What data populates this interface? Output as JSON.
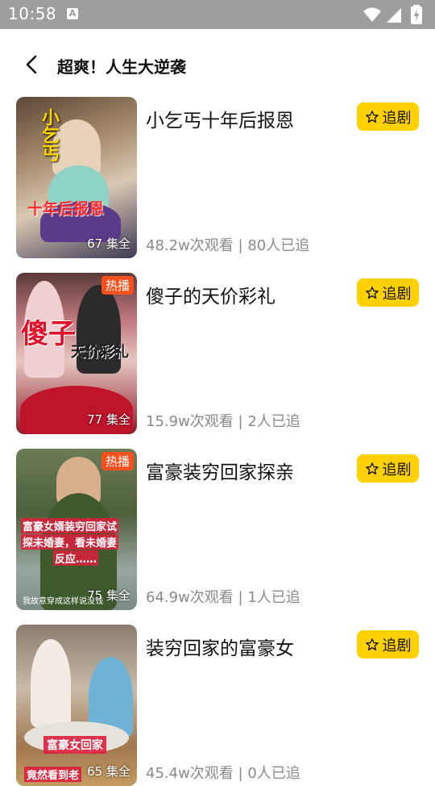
{
  "status_bar": {
    "time": "10:58",
    "a_icon": "A"
  },
  "header": {
    "title": "超爽！人生大逆袭"
  },
  "items": [
    {
      "title": "小乞丐十年后报恩",
      "follow_label": "追剧",
      "views": "48.2w次观看",
      "followers": "80人已追",
      "episodes": "67 集全",
      "hot": false,
      "overlay_lines": [
        "小乞丐",
        "十年后报恩"
      ]
    },
    {
      "title": "傻子的天价彩礼",
      "follow_label": "追剧",
      "views": "15.9w次观看",
      "followers": "2人已追",
      "episodes": "77 集全",
      "hot": true,
      "hot_label": "热播",
      "overlay_lines": [
        "傻子",
        "天价彩礼"
      ]
    },
    {
      "title": "富豪装穷回家探亲",
      "follow_label": "追剧",
      "views": "64.9w次观看",
      "followers": "1人已追",
      "episodes": "75 集全",
      "hot": true,
      "hot_label": "热播",
      "overlay_lines": [
        "富豪女婿装穷回家试",
        "探未婚妻，看未婚妻",
        "反应……",
        "我故意穿成这样说没钱"
      ]
    },
    {
      "title": "装穷回家的富豪女",
      "follow_label": "追剧",
      "views": "45.4w次观看",
      "followers": "0人已追",
      "episodes": "65 集全",
      "hot": false,
      "overlay_lines": [
        "富豪女回家",
        "竟然看到老"
      ]
    }
  ],
  "stats_separator": " | ",
  "icons": {
    "back": "chevron-left-icon",
    "follow": "star-outline-icon",
    "wifi": "wifi-icon",
    "signal": "signal-icon",
    "battery": "battery-icon"
  },
  "colors": {
    "accent": "#ffd100",
    "hot": "#f4511e",
    "status_bar": "#9e9e9e",
    "muted": "#8a8a8a"
  }
}
